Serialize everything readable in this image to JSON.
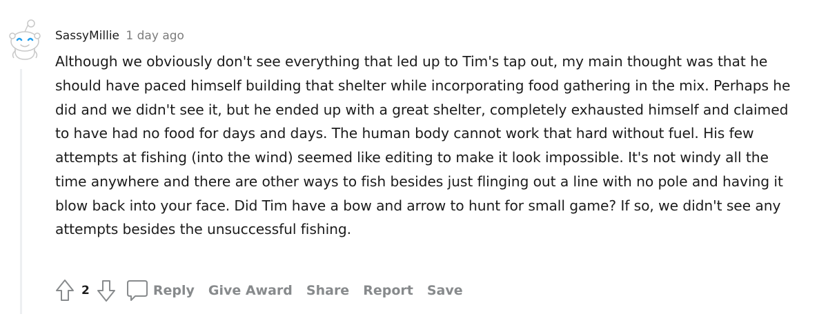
{
  "comment": {
    "author": "SassyMillie",
    "timestamp": "1 day ago",
    "body": "Although we obviously don't see everything that led up to Tim's tap out, my main thought was that he should have paced himself building that shelter while incorporating food gathering in the mix. Perhaps he did and we didn't see it, but he ended up with a great shelter, completely exhausted himself and claimed to have had no food for days and days. The human body cannot work that hard without fuel. His few attempts at fishing (into the wind) seemed like editing to make it look impossible. It's not windy all the time anywhere and there are other ways to fish besides just flinging out a line with no pole and having it blow back into your face. Did Tim have a bow and arrow to hunt for small game? If so, we didn't see any attempts besides the unsuccessful fishing.",
    "score": "2"
  },
  "actions": {
    "reply": "Reply",
    "give_award": "Give Award",
    "share": "Share",
    "report": "Report",
    "save": "Save"
  },
  "icons": {
    "avatar": "snoo-avatar-icon",
    "upvote": "upvote-arrow-icon",
    "downvote": "downvote-arrow-icon",
    "comment": "comment-bubble-icon"
  },
  "colors": {
    "action_text": "#878a8c",
    "meta_text": "#7c7c7c",
    "body_text": "#1c1c1c",
    "thread_line": "#edeff1"
  }
}
